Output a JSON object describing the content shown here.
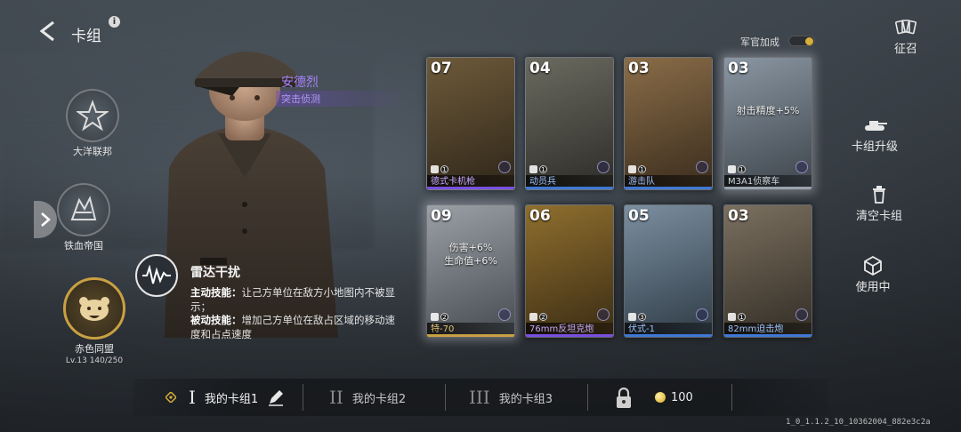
{
  "header": {
    "title": "卡组",
    "info": "i"
  },
  "factions": [
    {
      "label": "大洋联邦",
      "icon": "eagle-star-icon"
    },
    {
      "label": "铁血帝国",
      "icon": "lion-emblem-icon"
    },
    {
      "label": "赤色同盟",
      "icon": "bear-emblem-icon",
      "level": "Lv.13 140/250",
      "selected": true
    }
  ],
  "officer": {
    "name": "安德烈",
    "role": "突击侦测"
  },
  "skill": {
    "name": "雷达干扰",
    "active_label": "主动技能：",
    "active_text": "让己方单位在敌方小地图内不被显示；",
    "passive_label": "被动技能：",
    "passive_text": "增加己方单位在敌占区域的移动速度和占点速度"
  },
  "officer_bonus": {
    "label": "军官加成",
    "on": true
  },
  "cards": [
    {
      "cost": "07",
      "name": "德式卡机枪",
      "badge": "1",
      "rarity": "epic"
    },
    {
      "cost": "04",
      "name": "动员兵",
      "badge": "1",
      "rarity": "rare"
    },
    {
      "cost": "03",
      "name": "游击队",
      "badge": "1",
      "rarity": "rare"
    },
    {
      "cost": "03",
      "name": "M3A1侦察车",
      "badge": "1",
      "rarity": "common",
      "modifier": "射击精度+5%"
    },
    {
      "cost": "09",
      "name": "特-70",
      "badge": "2",
      "rarity": "legendary",
      "modifier_lines": [
        "伤害+6%",
        "生命值+6%"
      ]
    },
    {
      "cost": "06",
      "name": "76mm反坦克炮",
      "badge": "2",
      "rarity": "epic"
    },
    {
      "cost": "05",
      "name": "伏式-1",
      "badge": "3",
      "rarity": "rare"
    },
    {
      "cost": "03",
      "name": "82mm迫击炮",
      "badge": "1",
      "rarity": "rare"
    }
  ],
  "right_menu": {
    "recruit": "征召",
    "upgrade": "卡组升级",
    "clear": "清空卡组",
    "in_use": "使用中"
  },
  "decks": [
    {
      "roman": "I",
      "label": "我的卡组1",
      "active": true
    },
    {
      "roman": "II",
      "label": "我的卡组2",
      "active": false
    },
    {
      "roman": "III",
      "label": "我的卡组3",
      "active": false
    }
  ],
  "currency": {
    "amount": "100",
    "icon": "coin-icon"
  },
  "version": "1_0_1.1.2_10_10362004_882e3c2a",
  "colors": {
    "epic": "#7a4fe0",
    "rare": "#3f78d6",
    "common": "#9aa3ad",
    "legendary": "#c9a043",
    "officer_name": "#a883ff"
  }
}
